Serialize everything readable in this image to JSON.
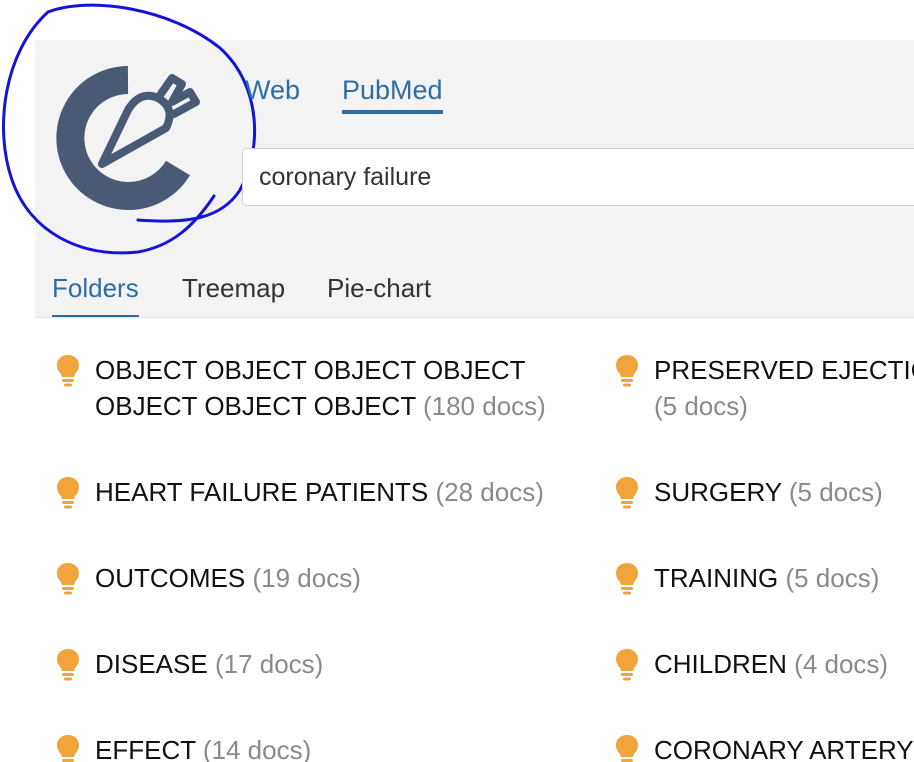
{
  "search_tabs": {
    "web": "Web",
    "pubmed": "PubMed"
  },
  "search": {
    "value": "coronary failure"
  },
  "view_tabs": {
    "folders": "Folders",
    "treemap": "Treemap",
    "piechart": "Pie-chart"
  },
  "folders": [
    {
      "label": "OBJECT OBJECT OBJECT OBJECT OBJECT OBJECT OBJECT",
      "count": "(180 docs)"
    },
    {
      "label": "PRESERVED EJECTIO",
      "count": "(5 docs)"
    },
    {
      "label": "HEART FAILURE PATIENTS",
      "count": "(28 docs)"
    },
    {
      "label": "SURGERY",
      "count": "(5 docs)"
    },
    {
      "label": "OUTCOMES",
      "count": "(19 docs)"
    },
    {
      "label": "TRAINING",
      "count": "(5 docs)"
    },
    {
      "label": "DISEASE",
      "count": "(17 docs)"
    },
    {
      "label": "CHILDREN",
      "count": "(4 docs)"
    },
    {
      "label": "EFFECT",
      "count": "(14 docs)"
    },
    {
      "label": "CORONARY ARTERY",
      "count": ""
    }
  ],
  "colors": {
    "accent": "#2e6da4",
    "logo": "#4a5a75",
    "bulb": "#f0a43a",
    "annotation": "#1414d8"
  }
}
